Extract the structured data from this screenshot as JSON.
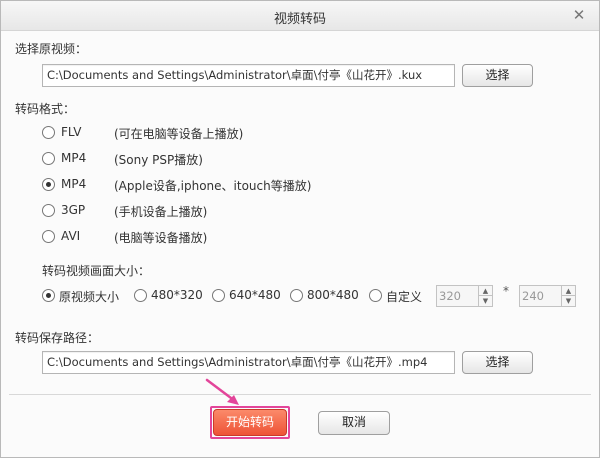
{
  "window": {
    "title": "视频转码",
    "close_icon_glyph": "✕"
  },
  "source": {
    "label": "选择原视频：",
    "path": "C:\\Documents and Settings\\Administrator\\卓面\\付亭《山花开》.kux",
    "browse_label": "选择"
  },
  "format": {
    "label": "转码格式：",
    "options": [
      {
        "name": "FLV",
        "desc": "(可在电脑等设备上播放)",
        "checked": false
      },
      {
        "name": "MP4",
        "desc": "(Sony PSP播放)",
        "checked": false
      },
      {
        "name": "MP4",
        "desc": "(Apple设备,iphone、itouch等播放)",
        "checked": true
      },
      {
        "name": "3GP",
        "desc": "(手机设备上播放)",
        "checked": false
      },
      {
        "name": "AVI",
        "desc": "(电脑等设备播放)",
        "checked": false
      }
    ]
  },
  "size": {
    "label": "转码视频画面大小：",
    "options": [
      {
        "name": "原视频大小",
        "checked": true
      },
      {
        "name": "480*320",
        "checked": false
      },
      {
        "name": "640*480",
        "checked": false
      },
      {
        "name": "800*480",
        "checked": false
      },
      {
        "name": "自定义",
        "checked": false
      }
    ],
    "custom_width": "320",
    "separator": "*",
    "custom_height": "240"
  },
  "output": {
    "label": "转码保存路径：",
    "path": "C:\\Documents and Settings\\Administrator\\卓面\\付亭《山花开》.mp4",
    "browse_label": "选择"
  },
  "actions": {
    "start_label": "开始转码",
    "cancel_label": "取消"
  },
  "colors": {
    "start_button": "#ee5336",
    "highlight": "#e3459a"
  }
}
